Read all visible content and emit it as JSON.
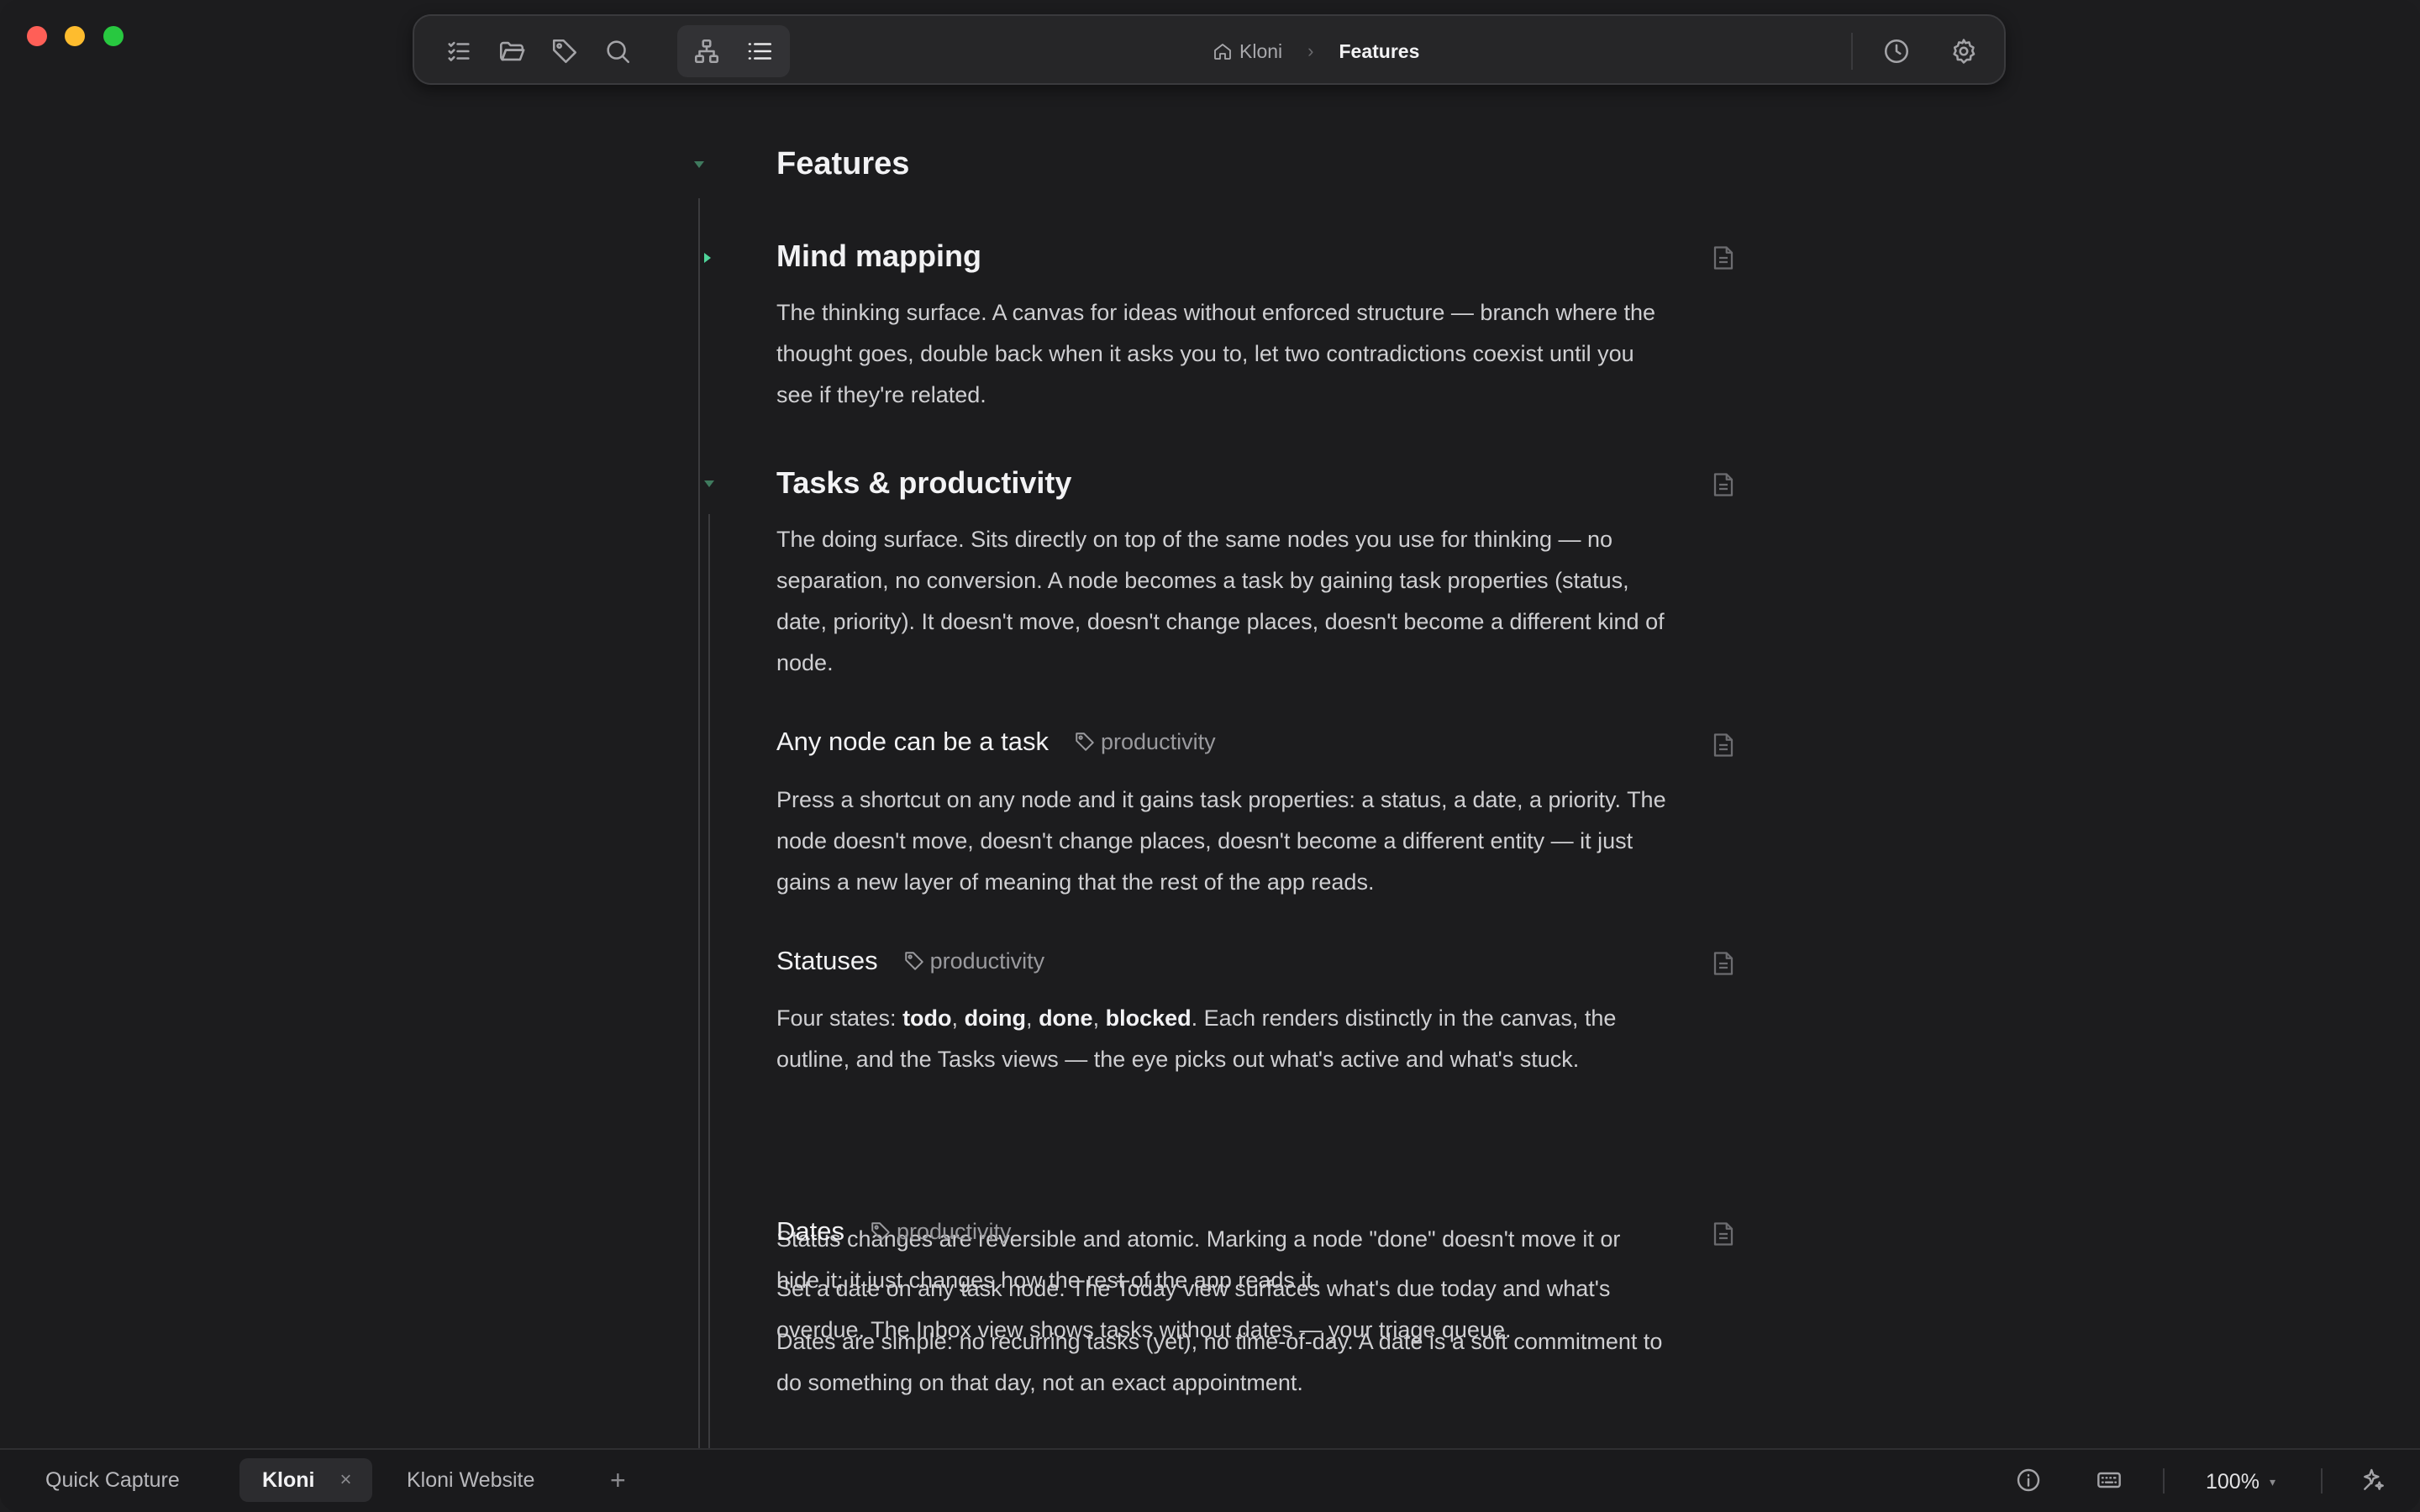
{
  "toolbar": {
    "icons": [
      "checklist-icon",
      "folder-icon",
      "tag-icon",
      "search-icon",
      "mindmap-icon",
      "outline-list-icon",
      "history-icon",
      "gear-icon"
    ],
    "breadcrumb": {
      "home": "Kloni",
      "current": "Features"
    }
  },
  "document": {
    "root_title": "Features",
    "sections": [
      {
        "title": "Mind mapping",
        "paragraphs": [
          "The thinking surface. A canvas for ideas without enforced structure — branch where the thought goes, double back when it asks you to, let two contradictions coexist until you see if they're related."
        ]
      },
      {
        "title": "Tasks & productivity",
        "paragraphs": [
          "The doing surface. Sits directly on top of the same nodes you use for thinking — no separation, no conversion. A node becomes a task by gaining task properties (status, date, priority). It doesn't move, doesn't change places, doesn't become a different kind of node."
        ],
        "children": [
          {
            "title": "Any node can be a task",
            "tag": "productivity",
            "paragraphs": [
              "Press a shortcut on any node and it gains task properties: a status, a date, a priority. The node doesn't move, doesn't change places, doesn't become a different entity — it just gains a new layer of meaning that the rest of the app reads."
            ]
          },
          {
            "title": "Statuses",
            "tag": "productivity",
            "p1_prefix": "Four states: ",
            "states": [
              "todo",
              "doing",
              "done",
              "blocked"
            ],
            "p1_suffix": ". Each renders distinctly in the canvas, the outline, and the Tasks views — the eye picks out what's active and what's stuck.",
            "p2": "Status changes are reversible and atomic. Marking a node \"done\" doesn't move it or hide it; it just changes how the rest of the app reads it."
          },
          {
            "title": "Dates",
            "tag": "productivity",
            "paragraphs": [
              "Set a date on any task node. The Today view surfaces what's due today and what's overdue. The Inbox view shows tasks without dates — your triage queue.",
              "Dates are simple: no recurring tasks (yet), no time-of-day. A date is a soft commitment to do something on that day, not an exact appointment."
            ]
          }
        ]
      }
    ]
  },
  "bottombar": {
    "tabs": [
      "Quick Capture",
      "Kloni",
      "Kloni Website"
    ],
    "active_tab_close": "×",
    "add_tab": "+",
    "zoom": "100%",
    "icons": [
      "info-icon",
      "keyboard-icon",
      "sparkle-icon"
    ]
  }
}
